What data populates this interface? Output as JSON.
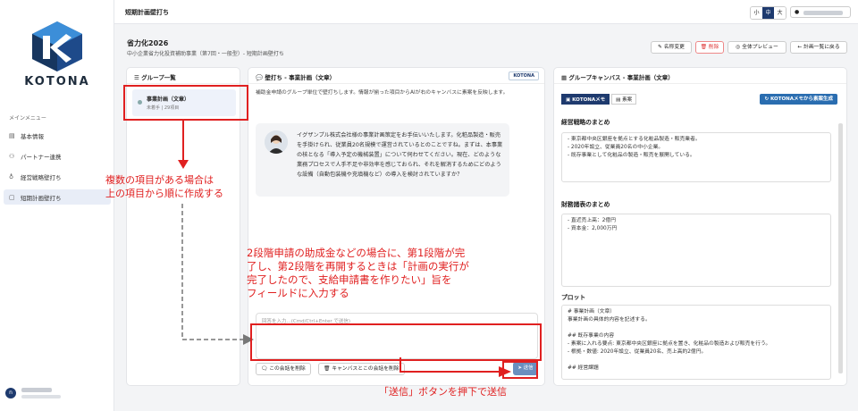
{
  "sidebar": {
    "logo": "KOTONA",
    "menu_heading": "メインメニュー",
    "items": [
      {
        "label": "基本情報",
        "icon": "document-icon"
      },
      {
        "label": "パートナー連携",
        "icon": "people-icon"
      },
      {
        "label": "経営戦略壁打ち",
        "icon": "bulb-icon"
      },
      {
        "label": "短期計画壁打ち",
        "icon": "file-icon",
        "active": true
      }
    ],
    "user_avatar": "n"
  },
  "topbar": {
    "title": "短期計画壁打ち",
    "sizes": [
      "小",
      "中",
      "大"
    ]
  },
  "project": {
    "title": "省力化2026",
    "subtitle": "中小企業省力化投資補助事業（第7回・一般型）- 短期計画壁打ち",
    "buttons": [
      "名称変更",
      "削除",
      "全体プレビュー",
      "計画一覧に戻る"
    ]
  },
  "group_panel": {
    "title": "グループ一覧",
    "item_name": "事業計画（文章）",
    "item_status": "未着手 | 29項目"
  },
  "chat_panel": {
    "title": "壁打ち - 事業計画（文章）",
    "tag": "KOTONA",
    "intro": "補助金申請のグループ単位で壁打ちします。情報が揃った項目からAIが右のキャンバスに素案を反映します。",
    "message": "イグザンプル株式会社様の事業計画策定をお手伝いいたします。化粧品製造・販売を手掛けられ、従業員20名規模で運営されているとのことですね。まずは、本事業の核となる「導入予定の機械装置」について伺わせてください。現在、どのような業務プロセスで人手不足や非効率を感じておられ、それを解消するためにどのような設備（自動包装機や充填機など）の導入を検討されていますか？",
    "placeholder": "回答を入力...(Cmd/Ctrl+Enter で送信)",
    "btn_delete": "この会話を削除",
    "btn_canvas": "キャンバスとこの会話を削除",
    "btn_send": "送信"
  },
  "canvas_panel": {
    "title": "グループキャンバス - 事業計画（文章）",
    "tab1": "KOTONAメモ",
    "tab2": "素案",
    "generate": "KOTONAメモから素案生成",
    "sections": [
      {
        "heading": "経営戦略のまとめ",
        "content": "- 東京都中央区銀座を拠点とする化粧品製造・販売業者。\n- 2020年設立、従業員20名の中小企業。\n- 既存事業として化粧品の製造・販売を展開している。"
      },
      {
        "heading": "財務諸表のまとめ",
        "content": "- 直近売上高：2億円\n- 資本金：2,000万円"
      },
      {
        "heading": "プロット",
        "content": "# 事業計画（文章）\n事業計画の具体的内容を記述する。\n\n## 既存事業の内容\n- 素案に入れる要点: 東京都中央区銀座に拠点を置き、化粧品の製造および販売を行う。\n- 根拠・数値: 2020年設立、従業員20名、売上高約2億円。\n\n## 経営課題"
      }
    ]
  },
  "annotations": {
    "note1": "複数の項目がある場合は\n上の項目から順に作成する",
    "note2": "2段階申請の助成金などの場合に、第1段階が完\n了し、第2段階を再開するときは「計画の実行が\n完了したので、支給申請書を作りたい」旨を\nフィールドに入力する",
    "note3": "「送信」ボタンを押下で送信"
  }
}
